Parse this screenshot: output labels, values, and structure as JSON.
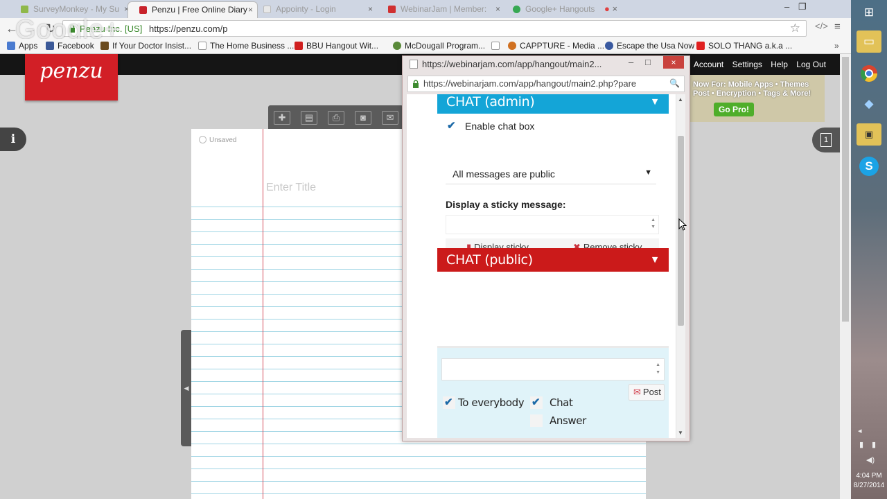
{
  "browser": {
    "tabs": [
      {
        "title": "SurveyMonkey - My Su",
        "active": false,
        "favicon_color": "#8fb84a"
      },
      {
        "title": "Penzu | Free Online Diary",
        "active": true,
        "favicon_color": "#c8232b"
      },
      {
        "title": "Appointy - Login",
        "active": false,
        "favicon_color": "#e8e8e8"
      },
      {
        "title": "WebinarJam | Member:",
        "active": false,
        "favicon_color": "#d03030"
      },
      {
        "title": "Google+ Hangouts",
        "active": false,
        "favicon_color": "#36a852"
      }
    ],
    "tab_close": "×",
    "secure_label": "Penzu Inc. [US]",
    "url": "https://penzu.com/p",
    "google_watermark": "Google+",
    "window_controls": {
      "minimize": "–",
      "restore": "❐",
      "close": "×"
    }
  },
  "bookmarks": [
    {
      "label": "Apps",
      "icon_color": "#4a7bd0"
    },
    {
      "label": "Facebook",
      "icon_color": "#3b5998"
    },
    {
      "label": "If Your Doctor Insist...",
      "icon_color": "#6b4b1e"
    },
    {
      "label": "The Home Business ...",
      "icon_color": "#ffffff"
    },
    {
      "label": "BBU Hangout Wit...",
      "icon_color": "#d02020"
    },
    {
      "label": "McDougall Program...",
      "icon_color": "#5a8a3a"
    },
    {
      "label": "",
      "icon_color": "#ffffff"
    },
    {
      "label": "CAPPTURE - Media ...",
      "icon_color": "#d07020"
    },
    {
      "label": "Escape the Usa Now",
      "icon_color": "#3a5aa0"
    },
    {
      "label": "SOLO THANG a.k.a ...",
      "icon_color": "#e02020"
    }
  ],
  "penzu": {
    "logo": "penzu",
    "nav": [
      "Account",
      "Settings",
      "Help",
      "Log Out"
    ],
    "promo_text": "Now For: Mobile Apps • Themes\nPost • Encryption • Tags & More!",
    "go_pro": "Go Pro!",
    "info_icon": "i",
    "journal_count": "1",
    "unsaved": "Unsaved",
    "title_placeholder": "Enter Title"
  },
  "popup": {
    "title": "https://webinarjam.com/app/hangout/main2...",
    "url": "https://webinarjam.com/app/hangout/main2.php?pare",
    "admin_header": "CHAT (admin)",
    "enable_chat": "Enable chat box",
    "message_mode": "All messages are public",
    "sticky_heading": "Display a sticky message:",
    "display_sticky": "Display sticky",
    "remove_sticky": "Remove sticky",
    "public_header": "CHAT (public)",
    "to_everybody": "To everybody",
    "chat_option": "Chat",
    "answer_option": "Answer",
    "post": "Post",
    "checked": {
      "enable_chat": true,
      "to_everybody": true,
      "chat": true,
      "answer": false
    }
  },
  "system": {
    "time": "4:04 PM",
    "date": "8/27/2014"
  },
  "colors": {
    "admin_header": "#14a5d7",
    "public_header": "#cb1a1a",
    "penzu_red": "#d21f26",
    "margin_line": "#d44b5a",
    "ruled_line": "#9fd5e4"
  }
}
